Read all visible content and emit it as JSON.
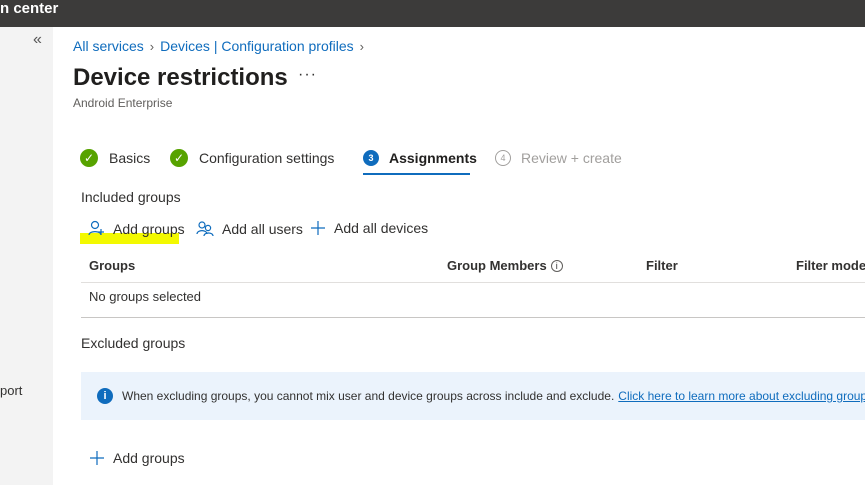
{
  "topbar": {
    "title": "n center"
  },
  "leftnav": {
    "collapse_glyph": "«",
    "fragment": "port"
  },
  "breadcrumb": [
    {
      "label": "All services"
    },
    {
      "label": "Devices | Configuration profiles"
    }
  ],
  "breadcrumb_sep": "›",
  "page": {
    "title": "Device restrictions",
    "more_glyph": "···",
    "subtitle": "Android Enterprise"
  },
  "wizard": {
    "steps": [
      {
        "label": "Basics",
        "status": "complete",
        "marker": "✓"
      },
      {
        "label": "Configuration settings",
        "status": "complete",
        "marker": "✓"
      },
      {
        "label": "Assignments",
        "status": "active",
        "marker": "3"
      },
      {
        "label": "Review + create",
        "status": "future",
        "marker": "4"
      }
    ]
  },
  "included": {
    "title": "Included groups",
    "actions": {
      "add_groups": "Add groups",
      "add_all_users": "Add all users",
      "add_all_devices": "Add all devices"
    },
    "columns": {
      "groups": "Groups",
      "group_members": "Group Members",
      "filter": "Filter",
      "filter_mode": "Filter mode"
    },
    "info_glyph": "i",
    "empty_text": "No groups selected"
  },
  "excluded": {
    "title": "Excluded groups",
    "banner_glyph": "i",
    "banner_text": "When excluding groups, you cannot mix user and device groups across include and exclude.",
    "banner_link": "Click here to learn more about excluding groups",
    "add_groups": "Add groups"
  },
  "colors": {
    "topbar": "#3c3b3a",
    "accent": "#0f6cbd",
    "success": "#57a300",
    "highlight": "#f3f900",
    "banner_bg": "#ebf3fc"
  }
}
